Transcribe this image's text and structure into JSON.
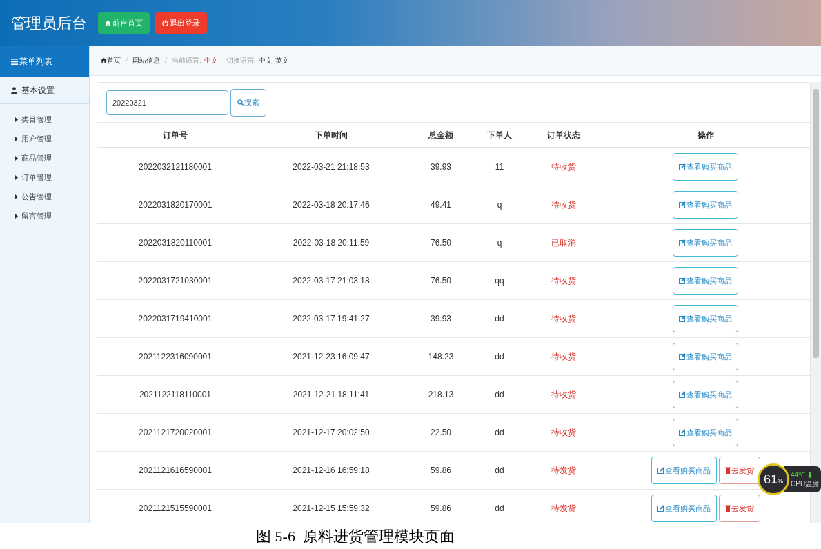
{
  "header": {
    "title": "管理员后台",
    "buttons": [
      {
        "kind": "home",
        "label": "前台首页"
      },
      {
        "kind": "logout",
        "label": "退出登录"
      }
    ]
  },
  "sidebar": {
    "title": "菜单列表",
    "section": "基本设置",
    "items": [
      "类目管理",
      "用户管理",
      "商品管理",
      "订单管理",
      "公告管理",
      "留言管理"
    ]
  },
  "breadcrumb": {
    "home": "首页",
    "page": "网站信息",
    "lang_label": "当前语言:",
    "lang_value": "中文",
    "switch_label": "切换语言:",
    "switch_options": [
      "中文",
      "英文"
    ]
  },
  "search": {
    "value": "20220321",
    "button": "搜索"
  },
  "table": {
    "columns": [
      "订单号",
      "下单时间",
      "总金额",
      "下单人",
      "订单状态",
      "操作"
    ],
    "rows": [
      {
        "cells": [
          "2022032121180001",
          "2022-03-21 21:18:53",
          "39.93",
          "11",
          "待收货"
        ],
        "actions": [
          {
            "kind": "view",
            "label": "查看购买商品"
          }
        ]
      },
      {
        "cells": [
          "2022031820170001",
          "2022-03-18 20:17:46",
          "49.41",
          "q",
          "待收货"
        ],
        "actions": [
          {
            "kind": "view",
            "label": "查看购买商品"
          }
        ]
      },
      {
        "cells": [
          "2022031820110001",
          "2022-03-18 20:11:59",
          "76.50",
          "q",
          "已取消"
        ],
        "actions": [
          {
            "kind": "view",
            "label": "查看购买商品"
          }
        ]
      },
      {
        "cells": [
          "2022031721030001",
          "2022-03-17 21:03:18",
          "76.50",
          "qq",
          "待收货"
        ],
        "actions": [
          {
            "kind": "view",
            "label": "查看购买商品"
          }
        ]
      },
      {
        "cells": [
          "2022031719410001",
          "2022-03-17 19:41:27",
          "39.93",
          "dd",
          "待收货"
        ],
        "actions": [
          {
            "kind": "view",
            "label": "查看购买商品"
          }
        ]
      },
      {
        "cells": [
          "2021122316090001",
          "2021-12-23 16:09:47",
          "148.23",
          "dd",
          "待收货"
        ],
        "actions": [
          {
            "kind": "view",
            "label": "查看购买商品"
          }
        ]
      },
      {
        "cells": [
          "2021122118110001",
          "2021-12-21 18:11:41",
          "218.13",
          "dd",
          "待收货"
        ],
        "actions": [
          {
            "kind": "view",
            "label": "查看购买商品"
          }
        ]
      },
      {
        "cells": [
          "2021121720020001",
          "2021-12-17 20:02:50",
          "22.50",
          "dd",
          "待收货"
        ],
        "actions": [
          {
            "kind": "view",
            "label": "查看购买商品"
          }
        ]
      },
      {
        "cells": [
          "2021121616590001",
          "2021-12-16 16:59:18",
          "59.86",
          "dd",
          "待发货"
        ],
        "actions": [
          {
            "kind": "view",
            "label": "查看购买商品"
          },
          {
            "kind": "ship",
            "label": "去发货"
          }
        ]
      },
      {
        "cells": [
          "2021121515590001",
          "2021-12-15 15:59:32",
          "59.86",
          "dd",
          "待发货"
        ],
        "actions": [
          {
            "kind": "view",
            "label": "查看购买商品"
          },
          {
            "kind": "ship",
            "label": "去发货"
          }
        ]
      }
    ]
  },
  "cpu_widget": {
    "percent": "61",
    "unit": "%",
    "temperature": "44℃",
    "label": "CPU温度"
  },
  "caption": "图 5-6  原料进货管理模块页面"
}
